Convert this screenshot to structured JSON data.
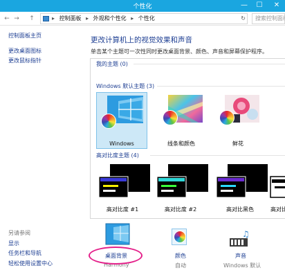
{
  "window": {
    "title": "个性化",
    "minimize": "—",
    "maximize": "☐",
    "close": "✕"
  },
  "nav": {
    "back": "←",
    "forward": "→",
    "up": "↑",
    "breadcrumb": [
      "控制面板",
      "外观和个性化",
      "个性化"
    ],
    "separator": "▸",
    "refresh": "↻",
    "search_placeholder": "搜索控制面板"
  },
  "sidebar": {
    "links": [
      "控制面板主页",
      "更改桌面图标",
      "更改鼠标指针"
    ],
    "see_also_heading": "另请参阅",
    "see_also": [
      "显示",
      "任务栏和导航",
      "轻松使用设置中心"
    ]
  },
  "main": {
    "title": "更改计算机上的视觉效果和声音",
    "description": "单击某个主题可一次性同时更改桌面背景、颜色、声音和屏幕保护程序。"
  },
  "themes": {
    "my_themes": "我的主题 (0)",
    "windows_heading": "Windows 默认主题 (3)",
    "windows_themes": [
      "Windows",
      "线条和颜色",
      "鲜花"
    ],
    "high_contrast_heading": "高对比度主题 (4)",
    "high_contrast_themes": [
      "高对比度 #1",
      "高对比度 #2",
      "高对比黑色",
      "高对比白"
    ]
  },
  "bottom": {
    "desktop_background": {
      "label": "桌面背景",
      "sub": "Harmony"
    },
    "color": {
      "label": "颜色",
      "sub": "自动"
    },
    "sounds": {
      "label": "声音",
      "sub": "Windows 默认"
    }
  },
  "colors": {
    "accent": "#1aa6e0",
    "link": "#1e3f93",
    "selection": "#cde8f7",
    "annotation": "#e4208a"
  }
}
